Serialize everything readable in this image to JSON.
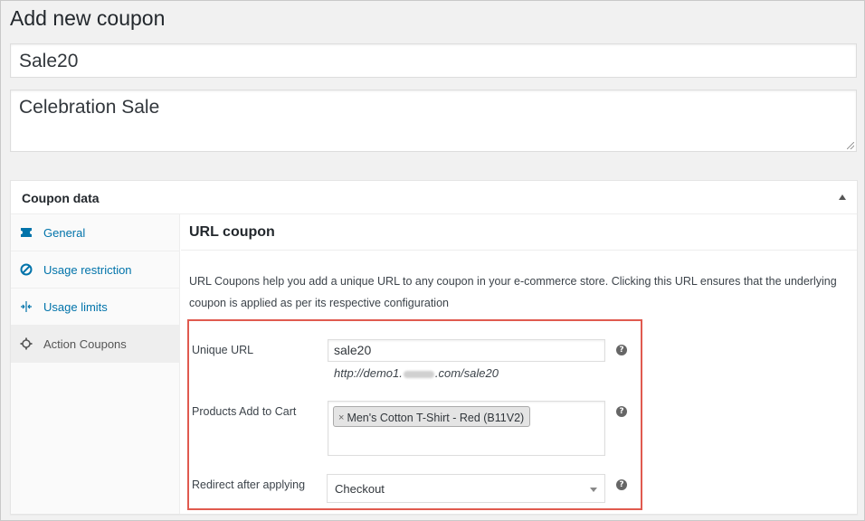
{
  "page": {
    "title": "Add new coupon"
  },
  "coupon": {
    "code": "Sale20",
    "description": "Celebration Sale"
  },
  "coupon_data": {
    "title": "Coupon data",
    "tabs": [
      {
        "label": "General",
        "icon": "ticket-icon"
      },
      {
        "label": "Usage restriction",
        "icon": "ban-icon"
      },
      {
        "label": "Usage limits",
        "icon": "arrows-icon"
      },
      {
        "label": "Action Coupons",
        "icon": "gear-icon"
      }
    ]
  },
  "url_coupon": {
    "title": "URL coupon",
    "description": "URL Coupons help you add a unique URL to any coupon in your e-commerce store. Clicking this URL ensures that the underlying coupon is applied as per its respective configuration",
    "unique_url_label": "Unique URL",
    "unique_url_value": "sale20",
    "url_prefix": "http://demo1.",
    "url_suffix": ".com/sale20",
    "products_label": "Products Add to Cart",
    "product_chip": "Men's Cotton T-Shirt - Red (B11V2)",
    "chip_remove": "×",
    "redirect_label": "Redirect after applying",
    "redirect_value": "Checkout",
    "help_glyph": "?"
  },
  "colors": {
    "link": "#0073aa",
    "highlight": "#e05a4f"
  }
}
